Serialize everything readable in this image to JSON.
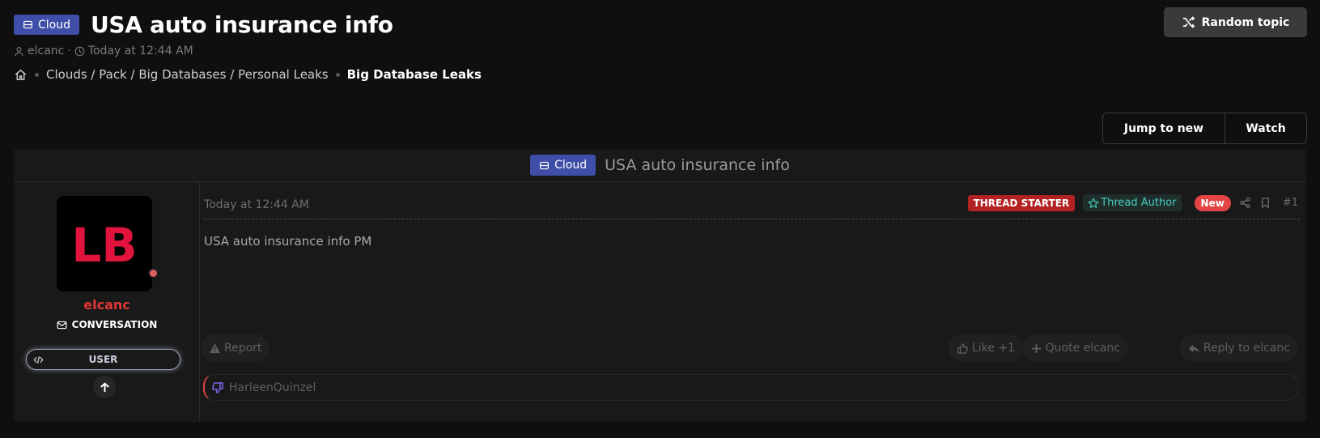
{
  "header": {
    "prefix": "Cloud",
    "title": "USA auto insurance info",
    "author": "elcanc",
    "sep": "·",
    "timestamp": "Today at 12:44 AM"
  },
  "breadcrumb": {
    "items": [
      "Clouds / Pack / Big Databases / Personal Leaks",
      "Big Database Leaks"
    ]
  },
  "buttons": {
    "random_topic": "Random topic",
    "jump_to_new": "Jump to new",
    "watch": "Watch"
  },
  "thread": {
    "prefix": "Cloud",
    "title": "USA auto insurance info"
  },
  "user": {
    "avatar_text": "LB",
    "name": "elcanc",
    "conversation": "CONVERSATION",
    "role": "USER",
    "online_color": "#e06060"
  },
  "post": {
    "time": "Today at 12:44 AM",
    "badges": {
      "starter": "THREAD STARTER",
      "author": "Thread Author",
      "new": "New"
    },
    "number": "#1",
    "body": "USA auto insurance info PM",
    "actions": {
      "report": "Report",
      "like": "Like +1",
      "quote": "Quote elcanc",
      "reply": "Reply to elcanc"
    },
    "reaction_user": "HarleenQuinzel"
  },
  "colors": {
    "accent": "#3f4ea8",
    "username": "#e03636",
    "starter": "#b32222",
    "author_text": "#46cfc0",
    "new": "#e34545",
    "background": "#0f0f0f",
    "panel": "#191919"
  },
  "icons": [
    "database-icon",
    "user-icon",
    "clock-icon",
    "home-icon",
    "shuffle-icon",
    "envelope-icon",
    "code-icon",
    "arrow-up-icon",
    "star-icon",
    "share-icon",
    "bookmark-icon",
    "warning-icon",
    "thumbs-up-icon",
    "plus-icon",
    "reply-icon",
    "thumbs-down-icon"
  ]
}
